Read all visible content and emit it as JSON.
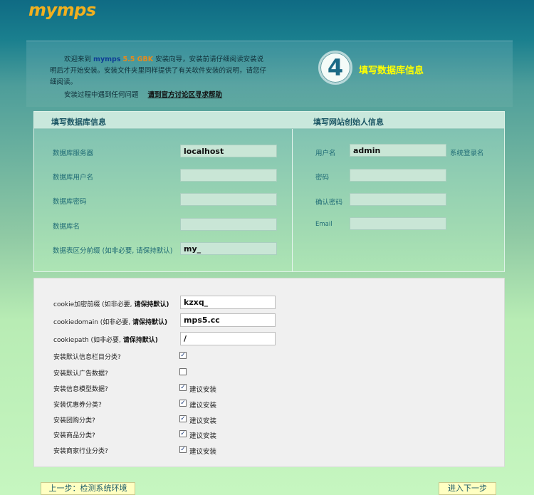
{
  "header": {
    "logo": "mymps"
  },
  "welcome": {
    "intro_prefix": "欢迎来到",
    "brand": "mymps",
    "version": "5.5 GBK",
    "intro_line1_suffix": "安装向导，安装前请仔细阅读安装说",
    "intro_line2": "明后才开始安装。安装文件夹里同样提供了有关软件安装的说明，请您仔",
    "intro_line3": "细阅读。",
    "help_text": "安装过程中遇到任何问题",
    "help_link": "请到官方讨论区寻求帮助",
    "step_number": "4",
    "step_title": "填写数据库信息"
  },
  "db_panel": {
    "left_header": "填写数据库信息",
    "right_header": "填写网站创始人信息",
    "fields": [
      {
        "label": "数据库服务器",
        "value": ""
      },
      {
        "label": "数据库用户名",
        "value": ""
      },
      {
        "label": "数据库密码",
        "value": ""
      },
      {
        "label": "数据库名",
        "value": ""
      },
      {
        "label": "数据表区分前缀 (如非必要, 请保持默认)",
        "value": "my_"
      }
    ],
    "server_value": "localhost",
    "admin_fields": [
      {
        "label": "用户名",
        "value": "admin"
      },
      {
        "label": "密码",
        "value": ""
      },
      {
        "label": "确认密码",
        "value": ""
      },
      {
        "label": "Email",
        "value": ""
      }
    ],
    "admin_note": "系统登录名"
  },
  "options": {
    "cookie_pre_label": "cookie加密前缀 (如非必要, ",
    "cookie_domain_label": "cookiedomain (如非必要, ",
    "cookie_path_label": "cookiepath (如非必要, ",
    "keep_default": "请保持默认)",
    "cookie_pre_value": "kzxq_",
    "cookie_domain_value": "mps5.cc",
    "cookie_path_value": "/",
    "checkboxes": [
      {
        "label": "安装默认信息栏目分类?",
        "checked": true,
        "note": ""
      },
      {
        "label": "安装默认广告数据?",
        "checked": false,
        "note": ""
      },
      {
        "label": "安装信息模型数据?",
        "checked": true,
        "note": "建议安装"
      },
      {
        "label": "安装优惠券分类?",
        "checked": true,
        "note": "建议安装"
      },
      {
        "label": "安装团购分类?",
        "checked": true,
        "note": "建议安装"
      },
      {
        "label": "安装商品分类?",
        "checked": true,
        "note": "建议安装"
      },
      {
        "label": "安装商家行业分类?",
        "checked": true,
        "note": "建议安装"
      }
    ]
  },
  "footer": {
    "prev_button": "上一步：检测系统环境",
    "next_button": "进入下一步"
  }
}
